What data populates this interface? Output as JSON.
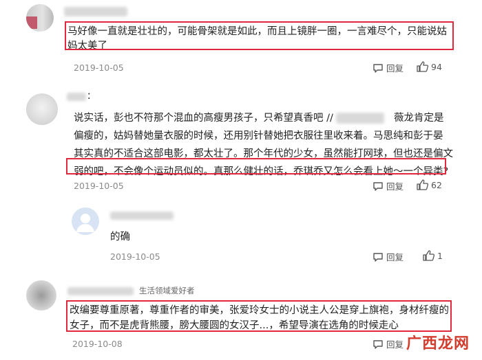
{
  "comments": [
    {
      "text_lines": [
        "马好像一直就是壮壮的，可能骨架就是如此，而且上镜胖一圈，一言难尽个，只能说姑",
        "妈太美了"
      ],
      "date": "2019-10-05",
      "reply_label": "回复",
      "likes": "94"
    },
    {
      "username_suffix": "：",
      "text_lines": [
        "说实话，彭也不符那个混血的高瘦男孩子，只希望真香吧 //",
        "薇龙肯定是",
        "偏瘦的，姑妈替她量衣服的时候，还用别针替她把衣服往里收来着。马思纯和彭于晏",
        "其实真的不适合这部电影，都太壮了。那个年代的少女，虽然能打网球，但也还是偏文",
        "弱的吧，不会像个运动员似的。真那么健壮的话，乔琪乔又怎么会看上她～一个异类?"
      ],
      "date": "2019-10-05",
      "reply_label": "回复",
      "likes": "62"
    },
    {
      "text": "的确",
      "date": "2019-10-05",
      "reply_label": "回复",
      "likes": "1"
    },
    {
      "tag": "生活领域爱好者",
      "text_lines": [
        "改编要尊重原著，尊重作者的审美，张爱玲女士的小说主人公是穿上旗袍，身材纤瘦的",
        "女子，而不是虎背熊腰，膀大腰圆的女汉子...，希望导演在选角的时候走心"
      ],
      "date": "2019-10-08",
      "reply_label": "回复"
    }
  ],
  "watermark": "广西龙网",
  "colors": {
    "highlight": "#e0283c",
    "date": "#8a8a8a",
    "watermark": "#d43b2c"
  }
}
